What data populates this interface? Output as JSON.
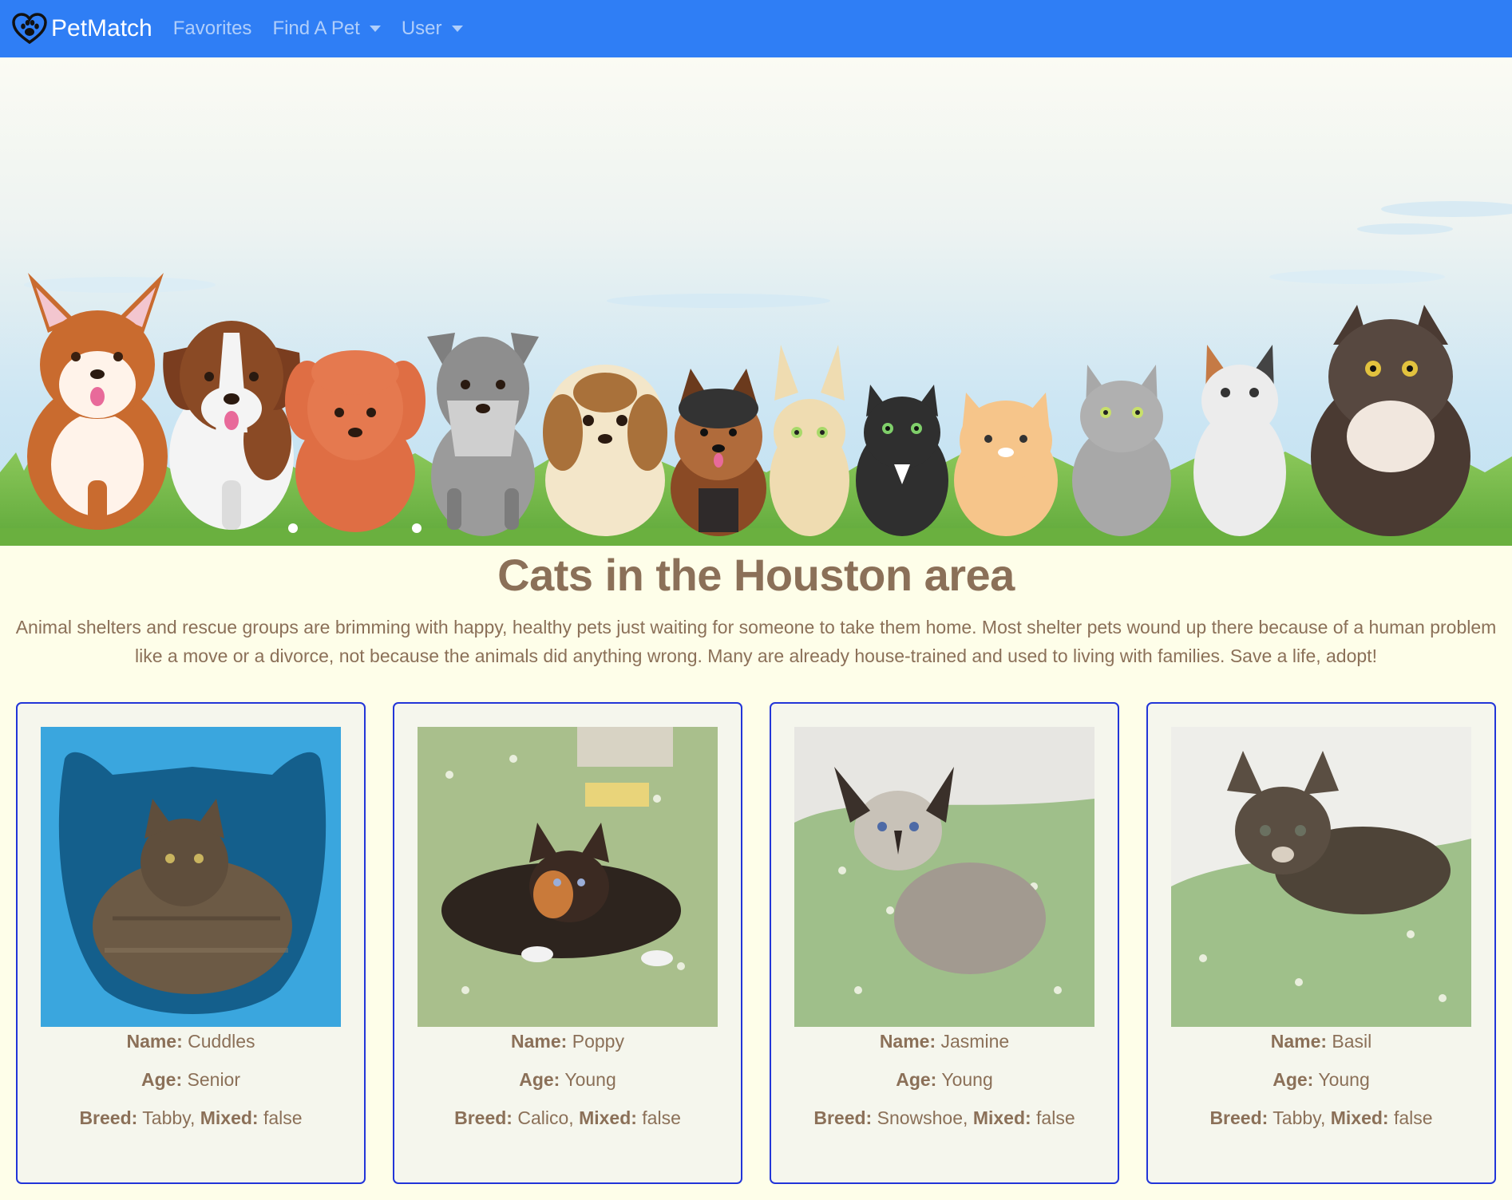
{
  "navbar": {
    "brand": "PetMatch",
    "brand_icon": "heart-paw-icon",
    "links": [
      {
        "label": "Favorites",
        "dropdown": false
      },
      {
        "label": "Find A Pet",
        "dropdown": true
      },
      {
        "label": "User",
        "dropdown": true
      }
    ],
    "color": "#2f7ef5"
  },
  "hero": {
    "illustration": "row-of-cartoon-dogs-and-cats-on-grass"
  },
  "page": {
    "title": "Cats in the Houston area",
    "intro": "Animal shelters and rescue groups are brimming with happy, healthy pets just waiting for someone to take them home. Most shelter pets wound up there because of a human problem like a move or a divorce, not because the animals did anything wrong. Many are already house-trained and used to living with families. Save a life, adopt!"
  },
  "labels": {
    "name": "Name:",
    "age": "Age:",
    "breed": "Breed:",
    "mixed": "Mixed:"
  },
  "cards": [
    {
      "name": "Cuddles",
      "age": "Senior",
      "breed": "Tabby",
      "mixed": "false"
    },
    {
      "name": "Poppy",
      "age": "Young",
      "breed": "Calico",
      "mixed": "false"
    },
    {
      "name": "Jasmine",
      "age": "Young",
      "breed": "Snowshoe",
      "mixed": "false"
    },
    {
      "name": "Basil",
      "age": "Young",
      "breed": "Tabby",
      "mixed": "false"
    }
  ],
  "colors": {
    "text": "#8b7058",
    "background": "#fefee9",
    "card_border": "#2235d8"
  }
}
